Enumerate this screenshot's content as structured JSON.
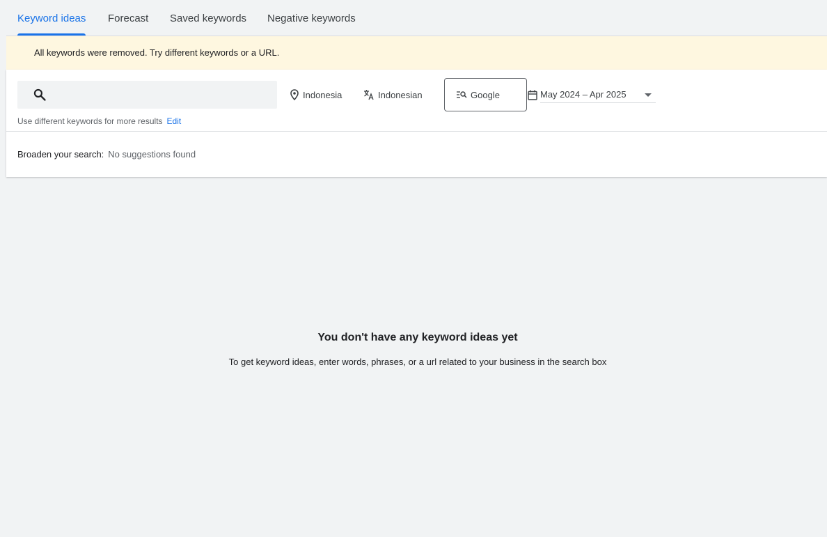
{
  "tabs": [
    {
      "label": "Keyword ideas",
      "active": true
    },
    {
      "label": "Forecast",
      "active": false
    },
    {
      "label": "Saved keywords",
      "active": false
    },
    {
      "label": "Negative keywords",
      "active": false
    }
  ],
  "banner": {
    "message": "All keywords were removed. Try different keywords or a URL."
  },
  "search": {
    "value": "",
    "icon": "search-icon",
    "hint": "Use different keywords for more results",
    "edit_label": "Edit"
  },
  "filters": {
    "location": {
      "label": "Indonesia",
      "icon": "location-pin-icon"
    },
    "language": {
      "label": "Indonesian",
      "icon": "translate-icon"
    },
    "network": {
      "label": "Google",
      "icon": "search-network-icon"
    },
    "date_range": {
      "label": "May 2024 – Apr 2025",
      "icon": "calendar-icon"
    }
  },
  "broaden": {
    "label": "Broaden your search:",
    "value": "No suggestions found"
  },
  "empty_state": {
    "title": "You don't have any keyword ideas yet",
    "subtitle": "To get keyword ideas, enter words, phrases, or a url related to your business in the search box"
  },
  "colors": {
    "accent": "#1a73e8",
    "banner_bg": "#fef7e0",
    "page_bg": "#f1f3f4"
  }
}
